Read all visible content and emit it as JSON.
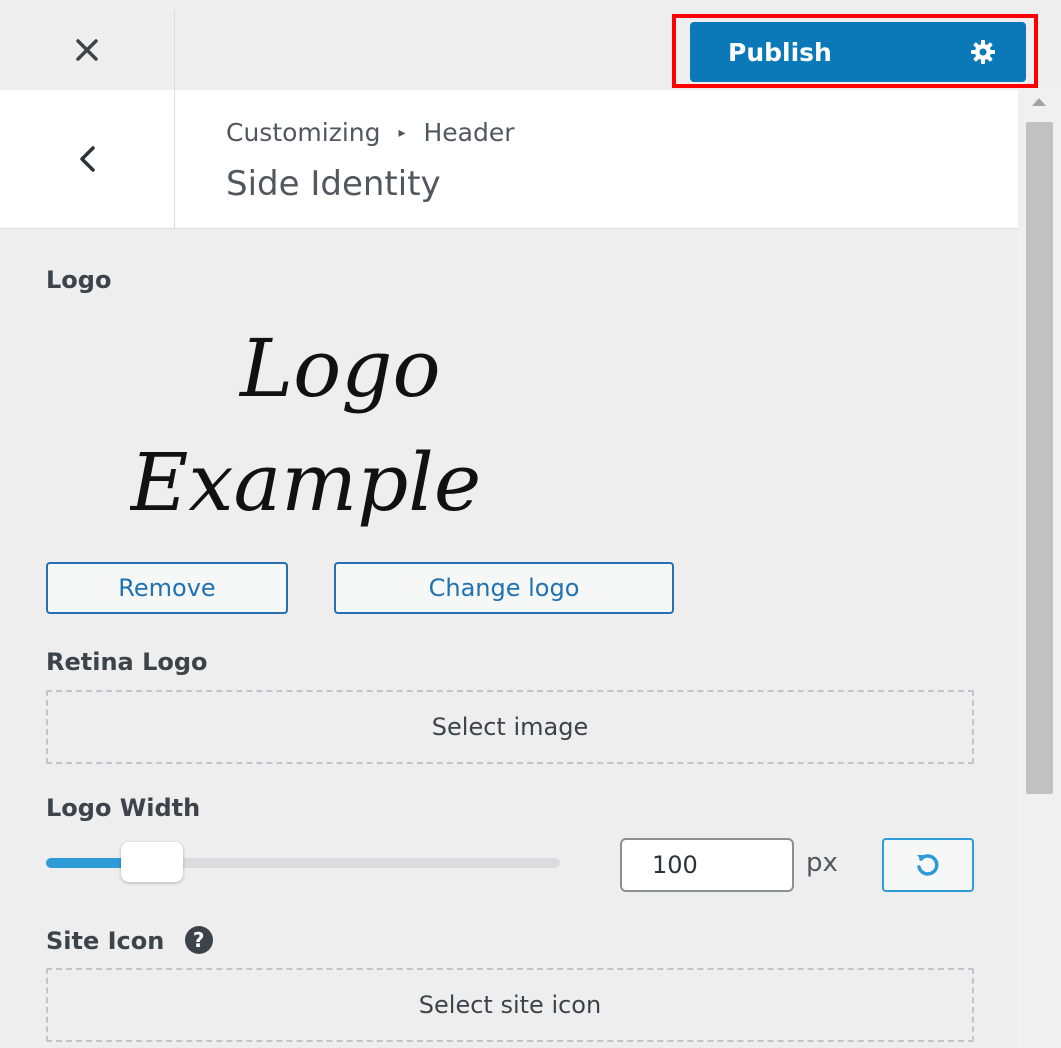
{
  "topbar": {
    "close_icon": "close-icon",
    "publish_label": "Publish",
    "settings_icon": "gear-icon",
    "highlight_color": "#ff0000",
    "publish_color": "#0b79b8"
  },
  "section": {
    "back_icon": "chevron-left-icon",
    "breadcrumb_parent": "Customizing",
    "breadcrumb_separator": "▸",
    "breadcrumb_current": "Header",
    "title": "Side Identity"
  },
  "logo": {
    "label": "Logo",
    "image_text_line1": "Logo",
    "image_text_line2": "Example",
    "remove_label": "Remove",
    "change_label": "Change logo"
  },
  "retina_logo": {
    "label": "Retina Logo",
    "select_label": "Select image"
  },
  "logo_width": {
    "label": "Logo Width",
    "value": "100",
    "unit": "px",
    "slider_fraction": 0.1,
    "reset_icon": "undo-icon"
  },
  "site_icon": {
    "label": "Site Icon",
    "help_icon": "help-icon",
    "select_label": "Select site icon"
  }
}
